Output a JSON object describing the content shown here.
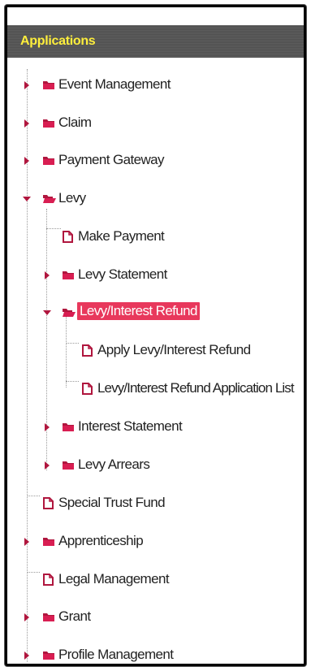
{
  "panel": {
    "title": "Applications"
  },
  "colors": {
    "header_text": "#ffef3c",
    "accent": "#b0163e",
    "selected_bg": "#e8385c"
  },
  "items": {
    "event_management": "Event Management",
    "claim": "Claim",
    "payment_gateway": "Payment Gateway",
    "levy": "Levy",
    "make_payment": "Make Payment",
    "levy_statement": "Levy Statement",
    "levy_interest_refund": "Levy/Interest Refund",
    "apply_refund": "Apply Levy/Interest Refund",
    "refund_application_list": "Levy/Interest Refund Application List",
    "interest_statement": "Interest Statement",
    "levy_arrears": "Levy Arrears",
    "special_trust_fund": "Special Trust Fund",
    "apprenticeship": "Apprenticeship",
    "legal_management": "Legal Management",
    "grant": "Grant",
    "profile_management": "Profile Management"
  },
  "icons": {
    "folder": "folder-icon",
    "page": "page-icon",
    "expander_collapsed": "caret-right-icon",
    "expander_expanded": "caret-down-icon"
  }
}
